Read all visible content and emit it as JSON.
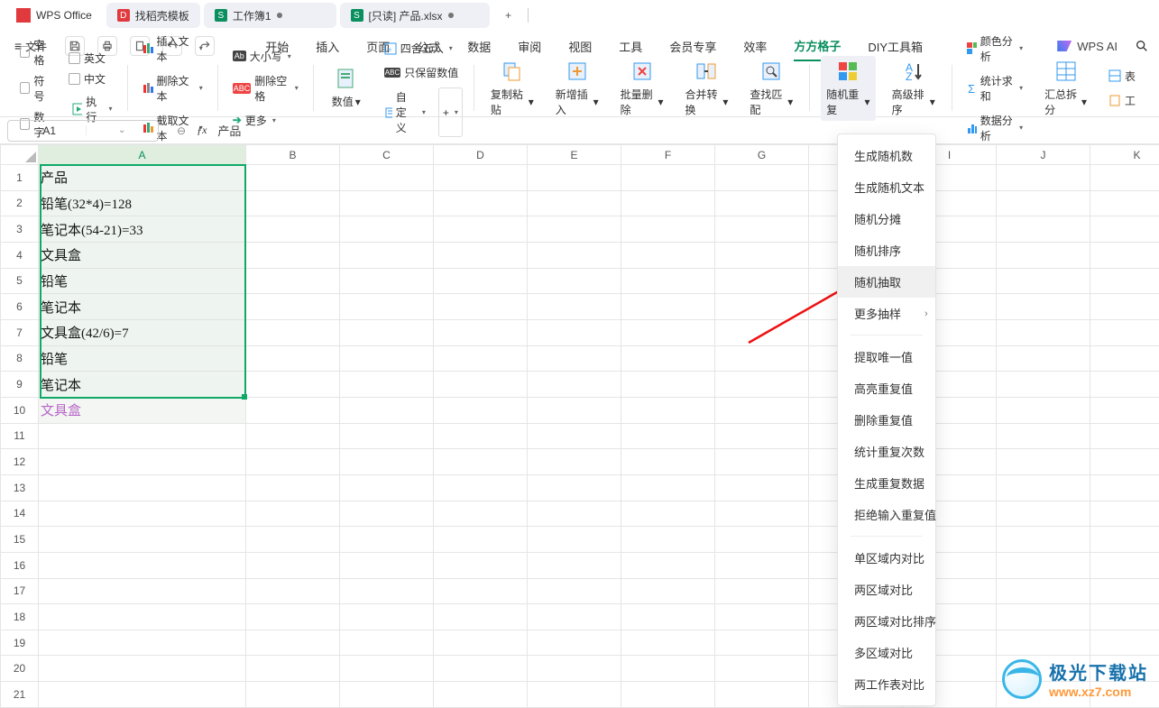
{
  "titlebar": {
    "app_name": "WPS Office",
    "tabs": [
      {
        "icon_color": "#e03a3e",
        "label": "找稻壳模板",
        "mono": "D"
      },
      {
        "icon_color": "#0a8f5f",
        "label": "工作簿1",
        "mono": "S",
        "modified": true
      },
      {
        "icon_color": "#0a8f5f",
        "label": "[只读] 产品.xlsx",
        "mono": "S",
        "modified": true
      }
    ],
    "new_tab": "+"
  },
  "menu": {
    "file": "文件",
    "tabs": [
      "开始",
      "插入",
      "页面",
      "公式",
      "数据",
      "审阅",
      "视图",
      "工具",
      "会员专享",
      "效率",
      "方方格子",
      "DIY工具箱"
    ],
    "active_tab": "方方格子",
    "wps_ai": "WPS AI"
  },
  "ribbon": {
    "g1": {
      "kongge": "空格",
      "fuhao": "符号",
      "shuzi": "数字",
      "ying": "英文",
      "zhong": "中文",
      "zhixing": "执行"
    },
    "g2": {
      "churuwenben": "插入文本",
      "shanchuwenben": "删除文本",
      "jiequwenben": "截取文本"
    },
    "g3": {
      "daxiao": "大小写",
      "shanchukongge": "删除空格",
      "gengduo": "更多"
    },
    "g4": {
      "shuzhi": "数值",
      "round": "四舍五入",
      "baoliu": "只保留数值",
      "zidingyi": "自定义",
      "plus": "+"
    },
    "g5": {
      "fuzhi": "复制粘贴",
      "xinzeng": "新增插入",
      "piliang": "批量删除",
      "hebing": "合并转换",
      "chazhao": "查找匹配"
    },
    "g6": {
      "suiji": "随机重复",
      "gaoji": "高级排序"
    },
    "g7": {
      "yanse": "颜色分析",
      "tongji": "统计求和",
      "shuju": "数据分析",
      "huizong": "汇总拆分",
      "biao": "表"
    }
  },
  "namebox": {
    "value": "A1"
  },
  "formula_bar": {
    "value": "产品"
  },
  "columns": [
    "A",
    "B",
    "C",
    "D",
    "E",
    "F",
    "G",
    "H",
    "I",
    "J",
    "K"
  ],
  "row_headers": [
    1,
    2,
    3,
    4,
    5,
    6,
    7,
    8,
    9,
    10,
    11,
    12,
    13,
    14,
    15,
    16,
    17,
    18,
    19,
    20,
    21
  ],
  "cells_A": [
    "产品",
    "铅笔(32*4)=128",
    "笔记本(54-21)=33",
    "文具盒",
    "铅笔",
    "笔记本",
    "文具盒(42/6)=7",
    "铅笔",
    "笔记本",
    "文具盒"
  ],
  "dropdown": {
    "items": [
      "生成随机数",
      "生成随机文本",
      "随机分摊",
      "随机排序",
      "随机抽取",
      "更多抽样",
      "提取唯一值",
      "高亮重复值",
      "删除重复值",
      "统计重复次数",
      "生成重复数据",
      "拒绝输入重复值",
      "单区域内对比",
      "两区域对比",
      "两区域对比排序",
      "多区域对比",
      "两工作表对比"
    ],
    "highlight_index": 4,
    "sub_after_index": 5,
    "sep_after_index": [
      5,
      11
    ]
  },
  "watermark": {
    "name": "极光下载站",
    "url": "www.xz7.com"
  }
}
